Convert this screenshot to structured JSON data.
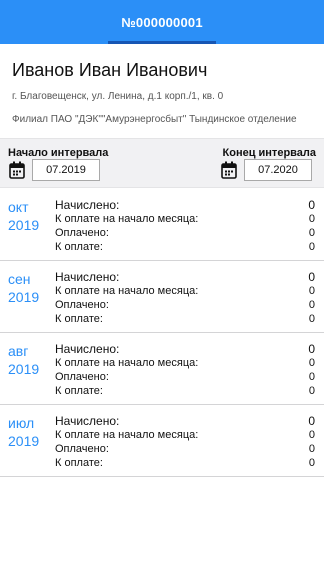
{
  "header": {
    "tab_label": "№000000001"
  },
  "account": {
    "name": "Иванов Иван Иванович",
    "address": "г. Благовещенск, ул. Ленина, д.1 корп./1, кв. 0",
    "branch": "Филиал ПАО \"ДЭК\"\"Амурэнергосбыт\" Тындинское отделение"
  },
  "interval": {
    "start_label": "Начало интервала",
    "start_value": "07.2019",
    "end_label": "Конец интервала",
    "end_value": "07.2020",
    "icon": "calendar-icon"
  },
  "periods": [
    {
      "month": "окт",
      "year": "2019",
      "accrued_label": "Начислено:",
      "accrued": "0",
      "opening_label": "К оплате на начало месяца:",
      "opening": "0",
      "paid_label": "Оплачено:",
      "paid": "0",
      "due_label": "К оплате:",
      "due": "0"
    },
    {
      "month": "сен",
      "year": "2019",
      "accrued_label": "Начислено:",
      "accrued": "0",
      "opening_label": "К оплате на начало месяца:",
      "opening": "0",
      "paid_label": "Оплачено:",
      "paid": "0",
      "due_label": "К оплате:",
      "due": "0"
    },
    {
      "month": "авг",
      "year": "2019",
      "accrued_label": "Начислено:",
      "accrued": "0",
      "opening_label": "К оплате на начало месяца:",
      "opening": "0",
      "paid_label": "Оплачено:",
      "paid": "0",
      "due_label": "К оплате:",
      "due": "0"
    },
    {
      "month": "июл",
      "year": "2019",
      "accrued_label": "Начислено:",
      "accrued": "0",
      "opening_label": "К оплате на начало месяца:",
      "opening": "0",
      "paid_label": "Оплачено:",
      "paid": "0",
      "due_label": "К оплате:",
      "due": "0"
    }
  ],
  "colors": {
    "header": "#2b8ff7",
    "tab_indicator": "#1656b4",
    "accent_text": "#2b8ff7"
  }
}
